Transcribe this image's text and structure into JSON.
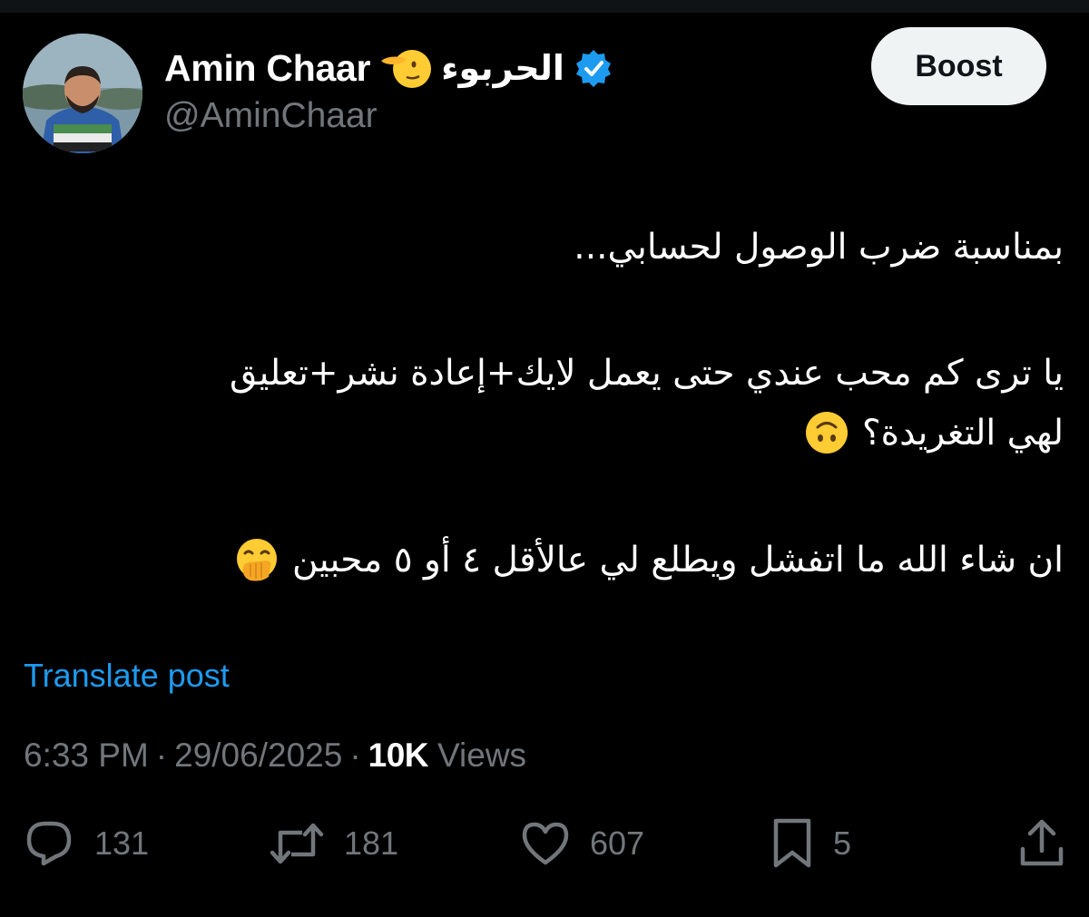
{
  "author": {
    "display_name": "Amin Chaar",
    "arabic_name": "الحربوء",
    "handle": "@AminChaar",
    "verified": true
  },
  "header": {
    "boost_label": "Boost"
  },
  "tweet": {
    "line1": "بمناسبة ضرب الوصول لحسابي...",
    "line2": "يا ترى كم محب عندي حتى يعمل لايك+إعادة نشر+تعليق",
    "line3": "لهي التغريدة؟",
    "line4": "ان شاء الله ما اتفشل ويطلع لي عالأقل ٤ أو ٥ محبين"
  },
  "translate_label": "Translate post",
  "meta": {
    "time": "6:33 PM",
    "separator": "·",
    "date": "29/06/2025",
    "views_count": "10K",
    "views_label": "Views"
  },
  "actions": {
    "replies": "131",
    "reposts": "181",
    "likes": "607",
    "bookmarks": "5"
  },
  "colors": {
    "background": "#000000",
    "link": "#1d9bf0",
    "muted": "#71767b",
    "verified": "#1d9bf0"
  },
  "icons": {
    "verified": "verified-badge-icon",
    "salute": "saluting-face-emoji",
    "upside_down": "upside-down-face-emoji",
    "hand_over_mouth": "face-with-hand-over-mouth-emoji",
    "reply": "reply-icon",
    "repost": "repost-icon",
    "like": "heart-icon",
    "bookmark": "bookmark-icon",
    "share": "share-icon"
  }
}
